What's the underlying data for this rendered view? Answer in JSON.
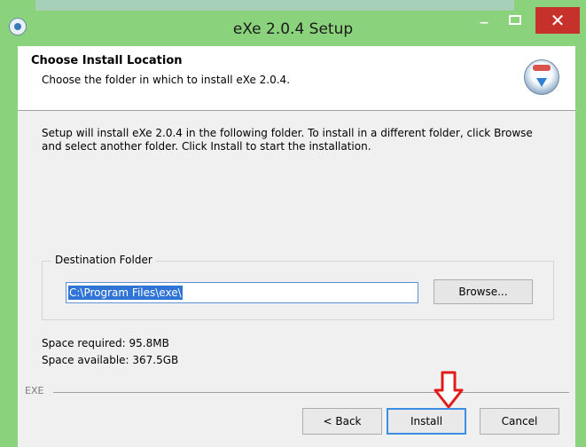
{
  "window": {
    "title": "eXe 2.0.4 Setup"
  },
  "header": {
    "title": "Choose Install Location",
    "subtitle": "Choose the folder in which to install eXe 2.0.4."
  },
  "body": {
    "info": "Setup will install eXe 2.0.4 in the following folder. To install in a different folder, click Browse and select another folder. Click Install to start the installation."
  },
  "destination": {
    "group_label": "Destination Folder",
    "path": "C:\\Program Files\\exe\\",
    "browse_label": "Browse..."
  },
  "space": {
    "required": "Space required: 95.8MB",
    "available": "Space available: 367.5GB"
  },
  "footer": {
    "brand": "EXE",
    "back_label": "< Back",
    "install_label": "Install",
    "cancel_label": "Cancel"
  },
  "colors": {
    "titlebar": "#8ad27c",
    "close_button": "#c7312b",
    "selection": "#3074d6",
    "focus_border": "#3c8ee5",
    "annotation_arrow": "#e21b1b"
  }
}
